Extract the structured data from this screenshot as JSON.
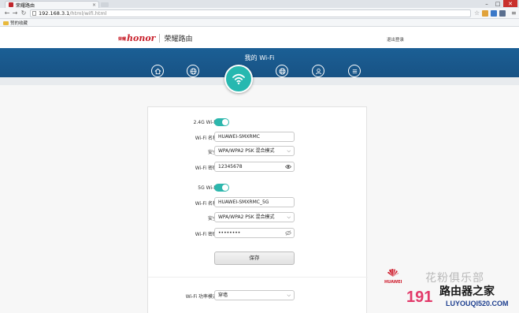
{
  "browser": {
    "tab_title": "荣耀路由",
    "tab_close": "×",
    "url_host": "192.168.3.1",
    "url_path": "/html/wifi.html",
    "bookmark_label": "赞的收藏",
    "back_glyph": "←",
    "forward_glyph": "→",
    "reload_glyph": "↻",
    "star_glyph": "☆",
    "menu_glyph": "≡",
    "min_glyph": "–",
    "max_glyph": "□",
    "close_glyph": "✕"
  },
  "header": {
    "logo_small": "荣耀",
    "logo_text": "honor",
    "brand": "荣耀路由",
    "logout": "退出登录"
  },
  "nav": {
    "title": "我的 Wi-Fi",
    "icons": [
      "home-icon",
      "globe-icon",
      "wifi-icon",
      "globe-settings-icon",
      "user-icon",
      "menu-icon"
    ]
  },
  "wifi24": {
    "toggle_label": "2.4G Wi-Fi",
    "enabled": true,
    "name_label": "Wi-Fi 名称",
    "name_value": "HUAWEI-SMXRMC",
    "security_label": "安全",
    "security_value": "WPA/WPA2 PSK 混合模式",
    "password_label": "Wi-Fi 密码",
    "password_value": "12345678"
  },
  "wifi5": {
    "toggle_label": "5G Wi-Fi",
    "enabled": true,
    "name_label": "Wi-Fi 名称",
    "name_value": "HUAWEI-SMXRMC_5G",
    "security_label": "安全",
    "security_value": "WPA/WPA2 PSK 混合模式",
    "password_label": "Wi-Fi 密码",
    "password_value": "••••••••"
  },
  "save_label": "保存",
  "power_mode": {
    "label": "Wi-Fi 功率模式",
    "value": "穿墙"
  },
  "watermark": {
    "brand": "HUAWEI",
    "text_top": "花粉俱乐部",
    "text_cn": "路由器之家",
    "text_num": "191",
    "text_url": "LUYOUQI520.COM"
  },
  "colors": {
    "accent": "#2db7ad",
    "header_blue": "#1b5f95",
    "brand_red": "#c8202b"
  }
}
